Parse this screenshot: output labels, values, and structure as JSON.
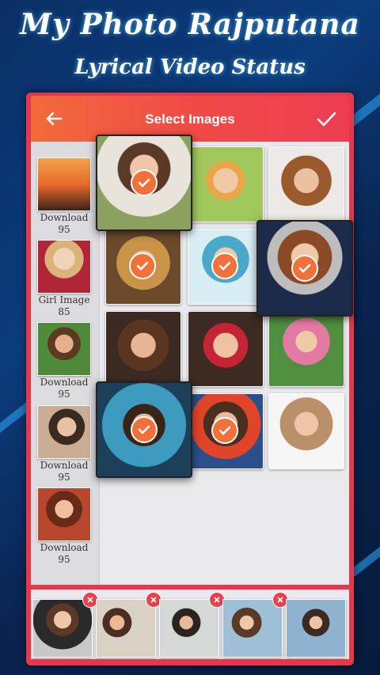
{
  "promo": {
    "title": "My Photo Rajputana",
    "subtitle": "Lyrical Video Status"
  },
  "toolbar": {
    "title": "Select Images",
    "back_icon": "back-arrow-icon",
    "done_icon": "check-icon"
  },
  "colors": {
    "accent": "#f04b46",
    "frame": "#e8374a",
    "check_badge": "#f2703a",
    "remove_badge": "#e8414d"
  },
  "albums": [
    {
      "name": "Download",
      "count": "95"
    },
    {
      "name": "Girl Image",
      "count": "85"
    },
    {
      "name": "Download",
      "count": "95"
    },
    {
      "name": "Download",
      "count": "95"
    },
    {
      "name": "Download",
      "count": "95"
    }
  ],
  "grid": [
    {
      "selected": true
    },
    {
      "selected": false
    },
    {
      "selected": false
    },
    {
      "selected": true
    },
    {
      "selected": true
    },
    {
      "selected": true
    },
    {
      "selected": false
    },
    {
      "selected": false
    },
    {
      "selected": false
    },
    {
      "selected": true
    },
    {
      "selected": true
    },
    {
      "selected": false
    }
  ],
  "tray": [
    {
      "removable": true
    },
    {
      "removable": true
    },
    {
      "removable": true
    },
    {
      "removable": true
    },
    {
      "removable": false
    }
  ]
}
